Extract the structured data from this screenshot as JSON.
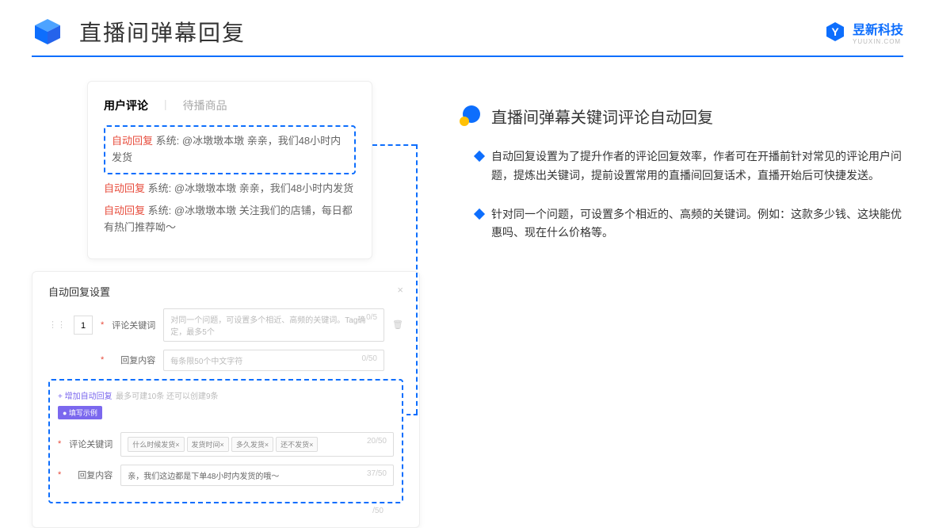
{
  "header": {
    "title": "直播间弹幕回复",
    "brand": "昱新科技",
    "brand_sub": "YUUXIN.COM"
  },
  "comments": {
    "tab1": "用户评论",
    "tab2": "待播商品",
    "row1_tag": "自动回复",
    "row1_sys": "系统:",
    "row1_text": "@冰墩墩本墩 亲亲，我们48小时内发货",
    "row2_tag": "自动回复",
    "row2_sys": "系统:",
    "row2_text": "@冰墩墩本墩 亲亲，我们48小时内发货",
    "row3_tag": "自动回复",
    "row3_sys": "系统:",
    "row3_text": "@冰墩墩本墩 关注我们的店铺，每日都有热门推荐呦～"
  },
  "settings": {
    "title": "自动回复设置",
    "num": "1",
    "label_kw": "评论关键词",
    "placeholder_kw": "对同一个问题，可设置多个相近、高频的关键词。Tag确定，最多5个",
    "count_kw": "0/5",
    "label_content": "回复内容",
    "placeholder_content": "每条限50个中文字符",
    "count_content": "0/50",
    "add_link": "+ 增加自动回复",
    "add_hint": "最多可建10条 还可以创建9条",
    "example_badge": "● 填写示例",
    "ex_label_kw": "评论关键词",
    "ex_tag1": "什么时候发货×",
    "ex_tag2": "发货时间×",
    "ex_tag3": "多久发货×",
    "ex_tag4": "还不发货×",
    "ex_kw_count": "20/50",
    "ex_label_content": "回复内容",
    "ex_content_val": "亲，我们这边都是下单48小时内发货的哦～",
    "ex_content_count": "37/50",
    "outer_count": "/50"
  },
  "right": {
    "section_title": "直播间弹幕关键词评论自动回复",
    "bullet1": "自动回复设置为了提升作者的评论回复效率，作者可在开播前针对常见的评论用户问题，提炼出关键词，提前设置常用的直播间回复话术，直播开始后可快捷发送。",
    "bullet2": "针对同一个问题，可设置多个相近的、高频的关键词。例如：这款多少钱、这块能优惠吗、现在什么价格等。"
  }
}
